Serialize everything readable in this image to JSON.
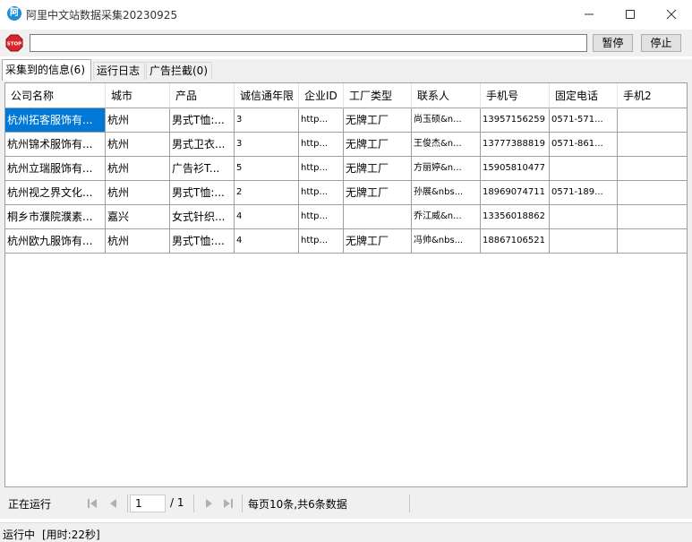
{
  "window": {
    "title": "阿里中文站数据采集20230925",
    "icon_glyph": "阿"
  },
  "toolbar": {
    "url_value": "",
    "pause_label": "暂停",
    "stop_label": "停止",
    "stop_icon_text": "STOP"
  },
  "tabs": [
    {
      "label": "采集到的信息(6)"
    },
    {
      "label": "运行日志"
    },
    {
      "label": "广告拦截(0)"
    }
  ],
  "table": {
    "columns": [
      "公司名称",
      "城市",
      "产品",
      "诚信通年限",
      "企业ID",
      "工厂类型",
      "联系人",
      "手机号",
      "固定电话",
      "手机2"
    ],
    "rows": [
      [
        "杭州拓客服饰有...",
        "杭州",
        "男式T恤:...",
        "3",
        "http...",
        "无牌工厂",
        "尚玉硕&n...",
        "13957156259",
        "0571-571...",
        ""
      ],
      [
        "杭州锦术服饰有...",
        "杭州",
        "男式卫衣...",
        "3",
        "http...",
        "无牌工厂",
        "王俊杰&n...",
        "13777388819",
        "0571-861...",
        ""
      ],
      [
        "杭州立瑞服饰有...",
        "杭州",
        "广告衫T...",
        "5",
        "http...",
        "无牌工厂",
        "方丽婷&n...",
        "15905810477",
        "",
        ""
      ],
      [
        "杭州视之界文化...",
        "杭州",
        "男式T恤:...",
        "2",
        "http...",
        "无牌工厂",
        "孙展&nbs...",
        "18969074711",
        "0571-189...",
        ""
      ],
      [
        "桐乡市濮院濮素...",
        "嘉兴",
        "女式针织...",
        "4",
        "http...",
        "",
        "乔江威&n...",
        "13356018862",
        "",
        ""
      ],
      [
        "杭州欧九服饰有...",
        "杭州",
        "男式T恤:...",
        "4",
        "http...",
        "无牌工厂",
        "冯帅&nbs...",
        "18867106521",
        "",
        ""
      ]
    ]
  },
  "pager": {
    "status": "正在运行",
    "page_value": "1",
    "page_total": "/ 1",
    "info": "每页10条,共6条数据"
  },
  "statusbar": {
    "run_state": "运行中",
    "elapsed": "[用时:22秒]"
  },
  "colors": {
    "selection": "#0078d7",
    "chrome": "#f0f0f0",
    "stop_red": "#d9262a"
  }
}
